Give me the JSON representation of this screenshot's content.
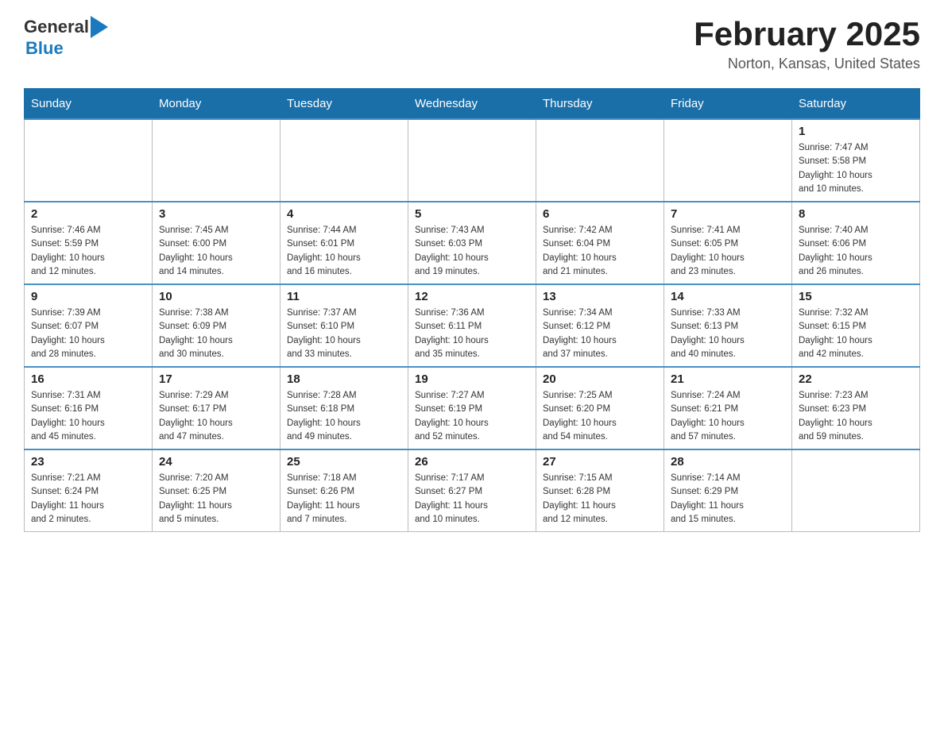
{
  "header": {
    "logo_general": "General",
    "logo_blue": "Blue",
    "month_title": "February 2025",
    "location": "Norton, Kansas, United States"
  },
  "days_of_week": [
    "Sunday",
    "Monday",
    "Tuesday",
    "Wednesday",
    "Thursday",
    "Friday",
    "Saturday"
  ],
  "weeks": [
    {
      "days": [
        {
          "number": "",
          "info": ""
        },
        {
          "number": "",
          "info": ""
        },
        {
          "number": "",
          "info": ""
        },
        {
          "number": "",
          "info": ""
        },
        {
          "number": "",
          "info": ""
        },
        {
          "number": "",
          "info": ""
        },
        {
          "number": "1",
          "info": "Sunrise: 7:47 AM\nSunset: 5:58 PM\nDaylight: 10 hours\nand 10 minutes."
        }
      ]
    },
    {
      "days": [
        {
          "number": "2",
          "info": "Sunrise: 7:46 AM\nSunset: 5:59 PM\nDaylight: 10 hours\nand 12 minutes."
        },
        {
          "number": "3",
          "info": "Sunrise: 7:45 AM\nSunset: 6:00 PM\nDaylight: 10 hours\nand 14 minutes."
        },
        {
          "number": "4",
          "info": "Sunrise: 7:44 AM\nSunset: 6:01 PM\nDaylight: 10 hours\nand 16 minutes."
        },
        {
          "number": "5",
          "info": "Sunrise: 7:43 AM\nSunset: 6:03 PM\nDaylight: 10 hours\nand 19 minutes."
        },
        {
          "number": "6",
          "info": "Sunrise: 7:42 AM\nSunset: 6:04 PM\nDaylight: 10 hours\nand 21 minutes."
        },
        {
          "number": "7",
          "info": "Sunrise: 7:41 AM\nSunset: 6:05 PM\nDaylight: 10 hours\nand 23 minutes."
        },
        {
          "number": "8",
          "info": "Sunrise: 7:40 AM\nSunset: 6:06 PM\nDaylight: 10 hours\nand 26 minutes."
        }
      ]
    },
    {
      "days": [
        {
          "number": "9",
          "info": "Sunrise: 7:39 AM\nSunset: 6:07 PM\nDaylight: 10 hours\nand 28 minutes."
        },
        {
          "number": "10",
          "info": "Sunrise: 7:38 AM\nSunset: 6:09 PM\nDaylight: 10 hours\nand 30 minutes."
        },
        {
          "number": "11",
          "info": "Sunrise: 7:37 AM\nSunset: 6:10 PM\nDaylight: 10 hours\nand 33 minutes."
        },
        {
          "number": "12",
          "info": "Sunrise: 7:36 AM\nSunset: 6:11 PM\nDaylight: 10 hours\nand 35 minutes."
        },
        {
          "number": "13",
          "info": "Sunrise: 7:34 AM\nSunset: 6:12 PM\nDaylight: 10 hours\nand 37 minutes."
        },
        {
          "number": "14",
          "info": "Sunrise: 7:33 AM\nSunset: 6:13 PM\nDaylight: 10 hours\nand 40 minutes."
        },
        {
          "number": "15",
          "info": "Sunrise: 7:32 AM\nSunset: 6:15 PM\nDaylight: 10 hours\nand 42 minutes."
        }
      ]
    },
    {
      "days": [
        {
          "number": "16",
          "info": "Sunrise: 7:31 AM\nSunset: 6:16 PM\nDaylight: 10 hours\nand 45 minutes."
        },
        {
          "number": "17",
          "info": "Sunrise: 7:29 AM\nSunset: 6:17 PM\nDaylight: 10 hours\nand 47 minutes."
        },
        {
          "number": "18",
          "info": "Sunrise: 7:28 AM\nSunset: 6:18 PM\nDaylight: 10 hours\nand 49 minutes."
        },
        {
          "number": "19",
          "info": "Sunrise: 7:27 AM\nSunset: 6:19 PM\nDaylight: 10 hours\nand 52 minutes."
        },
        {
          "number": "20",
          "info": "Sunrise: 7:25 AM\nSunset: 6:20 PM\nDaylight: 10 hours\nand 54 minutes."
        },
        {
          "number": "21",
          "info": "Sunrise: 7:24 AM\nSunset: 6:21 PM\nDaylight: 10 hours\nand 57 minutes."
        },
        {
          "number": "22",
          "info": "Sunrise: 7:23 AM\nSunset: 6:23 PM\nDaylight: 10 hours\nand 59 minutes."
        }
      ]
    },
    {
      "days": [
        {
          "number": "23",
          "info": "Sunrise: 7:21 AM\nSunset: 6:24 PM\nDaylight: 11 hours\nand 2 minutes."
        },
        {
          "number": "24",
          "info": "Sunrise: 7:20 AM\nSunset: 6:25 PM\nDaylight: 11 hours\nand 5 minutes."
        },
        {
          "number": "25",
          "info": "Sunrise: 7:18 AM\nSunset: 6:26 PM\nDaylight: 11 hours\nand 7 minutes."
        },
        {
          "number": "26",
          "info": "Sunrise: 7:17 AM\nSunset: 6:27 PM\nDaylight: 11 hours\nand 10 minutes."
        },
        {
          "number": "27",
          "info": "Sunrise: 7:15 AM\nSunset: 6:28 PM\nDaylight: 11 hours\nand 12 minutes."
        },
        {
          "number": "28",
          "info": "Sunrise: 7:14 AM\nSunset: 6:29 PM\nDaylight: 11 hours\nand 15 minutes."
        },
        {
          "number": "",
          "info": ""
        }
      ]
    }
  ]
}
